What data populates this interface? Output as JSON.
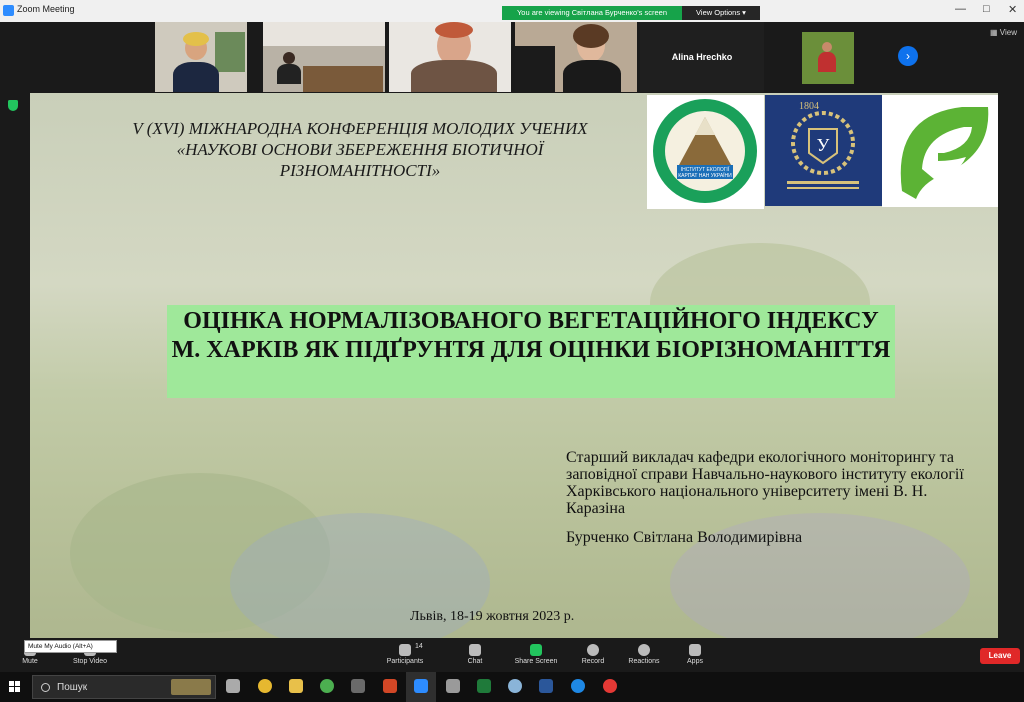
{
  "window": {
    "title": "Zoom Meeting"
  },
  "share_banner": {
    "text": "You are viewing Світлана Бурченко's screen",
    "view_options": "View Options"
  },
  "video_strip": {
    "participant_name": "Alina Hrechko",
    "view_label": "View"
  },
  "slide": {
    "conference": "V (XVI) МІЖНАРОДНА КОНФЕРЕНЦІЯ МОЛОДИХ УЧЕНИХ «НАУКОВІ ОСНОВИ ЗБЕРЕЖЕННЯ БІОТИЧНОЇ РІЗНОМАНІТНОСТІ»",
    "logo1_text": "ІНСТИТУТ ЕКОЛОГІЇ КАРПАТ НАН УКРАЇНИ",
    "logo2_text": "1804",
    "title": "ОЦІНКА НОРМАЛІЗОВАНОГО ВЕГЕТАЦІЙНОГО ІНДЕКСУ М. ХАРКІВ ЯК ПІДҐРУНТЯ ДЛЯ ОЦІНКИ БІОРІЗНОМАНІТТЯ",
    "affiliation": "Старший викладач кафедри екологічного моніторингу та заповідної справи Навчально-наукового інституту екології Харківського національного університету імені В. Н. Каразіна",
    "author": "Бурченко Світлана Володимирівна",
    "date": "Львів, 18-19 жовтня 2023 р."
  },
  "controls": {
    "tooltip": "Mute My Audio (Alt+A)",
    "mute": "Mute",
    "stop_video": "Stop Video",
    "participants": "Participants",
    "participants_count": "14",
    "chat": "Chat",
    "share_screen": "Share Screen",
    "record": "Record",
    "reactions": "Reactions",
    "apps": "Apps",
    "leave": "Leave"
  },
  "taskbar": {
    "search_placeholder": "Пошук"
  },
  "colors": {
    "zoom_blue": "#2d8cff",
    "share_green": "#16a34a",
    "leave_red": "#e02828",
    "title_box": "#9fe89a"
  }
}
